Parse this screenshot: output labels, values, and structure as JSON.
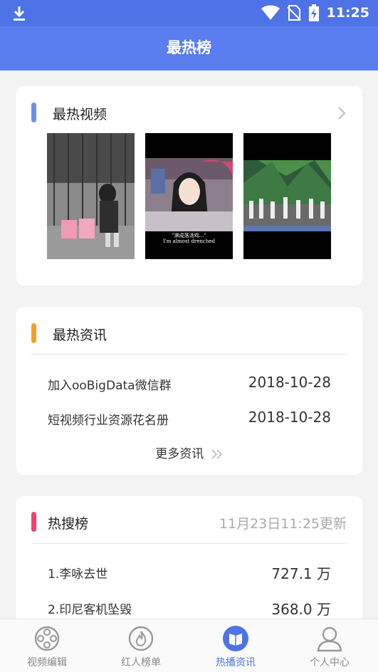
{
  "status": {
    "time": "11:25"
  },
  "header": {
    "title": "最热榜"
  },
  "hot_videos": {
    "title": "最热视频",
    "videos": [
      {
        "caption": ""
      },
      {
        "caption_line1": "\"淋成落汤鸡...\"",
        "caption_line2": "I'm almost drenched"
      },
      {
        "caption": ""
      }
    ]
  },
  "hot_news": {
    "title": "最热资讯",
    "items": [
      {
        "label": "加入ooBigData微信群",
        "date": "2018-10-28"
      },
      {
        "label": "短视频行业资源花名册",
        "date": "2018-10-28"
      }
    ],
    "more_label": "更多资讯"
  },
  "hot_search": {
    "title": "热搜榜",
    "updated": "11月23日11:25更新",
    "items": [
      {
        "label": "1.李咏去世",
        "value": "727.1 万"
      },
      {
        "label": "2.印尼客机坠毁",
        "value": "368.0 万"
      }
    ]
  },
  "tabs": [
    {
      "label": "视频编辑",
      "icon": "film-reel-icon"
    },
    {
      "label": "红人榜单",
      "icon": "flame-icon"
    },
    {
      "label": "热播资讯",
      "icon": "news-icon"
    },
    {
      "label": "个人中心",
      "icon": "user-icon"
    }
  ],
  "colors": {
    "primary": "#5a7df0",
    "bar_videos": "#6e8ff0",
    "bar_news": "#f5a020",
    "bar_search": "#f0426d",
    "active_tab": "#4e73e6"
  }
}
